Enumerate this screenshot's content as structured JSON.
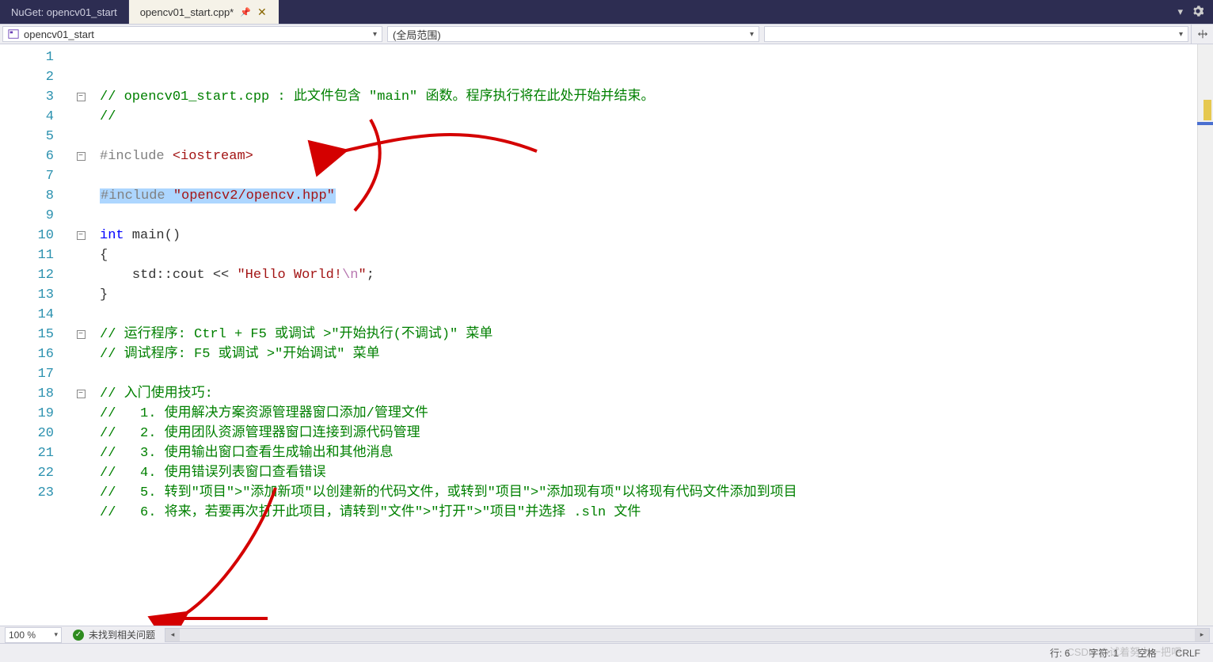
{
  "tabs": {
    "inactive": "NuGet: opencv01_start",
    "active": "opencv01_start.cpp*"
  },
  "nav": {
    "scope_left": "opencv01_start",
    "scope_mid": "(全局范围)",
    "scope_right": ""
  },
  "code": {
    "lines": [
      {
        "n": 1,
        "fold": "minus",
        "mod": false,
        "segs": [
          [
            "c-comment",
            "// opencv01_start.cpp : 此文件包含 \"main\" 函数。程序执行将在此处开始并结束。"
          ]
        ]
      },
      {
        "n": 2,
        "fold": "",
        "mod": false,
        "segs": [
          [
            "c-comment",
            "//"
          ]
        ]
      },
      {
        "n": 3,
        "fold": "",
        "mod": false,
        "segs": []
      },
      {
        "n": 4,
        "fold": "minus",
        "mod": true,
        "segs": [
          [
            "c-preproc",
            "#include "
          ],
          [
            "c-angle",
            "<iostream>"
          ]
        ]
      },
      {
        "n": 5,
        "fold": "",
        "mod": true,
        "segs": []
      },
      {
        "n": 6,
        "fold": "",
        "mod": true,
        "sel": true,
        "segs": [
          [
            "c-preproc",
            "#include "
          ],
          [
            "c-string",
            "\"opencv2/opencv.hpp\""
          ]
        ]
      },
      {
        "n": 7,
        "fold": "",
        "mod": false,
        "segs": []
      },
      {
        "n": 8,
        "fold": "minus",
        "mod": false,
        "segs": [
          [
            "c-keyword",
            "int"
          ],
          [
            "c-ident",
            " main"
          ],
          [
            "c-punct",
            "()"
          ]
        ]
      },
      {
        "n": 9,
        "fold": "",
        "mod": false,
        "segs": [
          [
            "c-punct",
            "{"
          ]
        ]
      },
      {
        "n": 10,
        "fold": "",
        "mod": false,
        "indent": "    ",
        "segs": [
          [
            "c-ident",
            "std"
          ],
          [
            "c-punct",
            "::"
          ],
          [
            "c-ident",
            "cout "
          ],
          [
            "c-punct",
            "<< "
          ],
          [
            "c-string",
            "\"Hello World!"
          ],
          [
            "c-escape",
            "\\n"
          ],
          [
            "c-string",
            "\""
          ],
          [
            "c-punct",
            ";"
          ]
        ]
      },
      {
        "n": 11,
        "fold": "",
        "mod": false,
        "segs": [
          [
            "c-punct",
            "}"
          ]
        ]
      },
      {
        "n": 12,
        "fold": "",
        "mod": false,
        "segs": []
      },
      {
        "n": 13,
        "fold": "minus",
        "mod": false,
        "segs": [
          [
            "c-comment",
            "// 运行程序: Ctrl + F5 或调试 >\"开始执行(不调试)\" 菜单"
          ]
        ]
      },
      {
        "n": 14,
        "fold": "",
        "mod": false,
        "segs": [
          [
            "c-comment",
            "// 调试程序: F5 或调试 >\"开始调试\" 菜单"
          ]
        ]
      },
      {
        "n": 15,
        "fold": "",
        "mod": false,
        "segs": []
      },
      {
        "n": 16,
        "fold": "minus",
        "mod": false,
        "segs": [
          [
            "c-comment",
            "// 入门使用技巧: "
          ]
        ]
      },
      {
        "n": 17,
        "fold": "",
        "mod": false,
        "segs": [
          [
            "c-comment",
            "//   1. 使用解决方案资源管理器窗口添加/管理文件"
          ]
        ]
      },
      {
        "n": 18,
        "fold": "",
        "mod": false,
        "segs": [
          [
            "c-comment",
            "//   2. 使用团队资源管理器窗口连接到源代码管理"
          ]
        ]
      },
      {
        "n": 19,
        "fold": "",
        "mod": false,
        "segs": [
          [
            "c-comment",
            "//   3. 使用输出窗口查看生成输出和其他消息"
          ]
        ]
      },
      {
        "n": 20,
        "fold": "",
        "mod": false,
        "segs": [
          [
            "c-comment",
            "//   4. 使用错误列表窗口查看错误"
          ]
        ]
      },
      {
        "n": 21,
        "fold": "",
        "mod": false,
        "segs": [
          [
            "c-comment",
            "//   5. 转到\"项目\">\"添加新项\"以创建新的代码文件，或转到\"项目\">\"添加现有项\"以将现有代码文件添加到项目"
          ]
        ]
      },
      {
        "n": 22,
        "fold": "",
        "mod": false,
        "segs": [
          [
            "c-comment",
            "//   6. 将来，若要再次打开此项目，请转到\"文件\">\"打开\">\"项目\"并选择 .sln 文件"
          ]
        ]
      },
      {
        "n": 23,
        "fold": "",
        "mod": false,
        "segs": []
      }
    ]
  },
  "bottom": {
    "zoom": "100 %",
    "no_issues": "未找到相关问题"
  },
  "status": {
    "line": "行: 6",
    "col": "字符: 1",
    "ins": "空格",
    "eol": "CRLF"
  },
  "watermark": "CSDN @试着努力一把吧"
}
